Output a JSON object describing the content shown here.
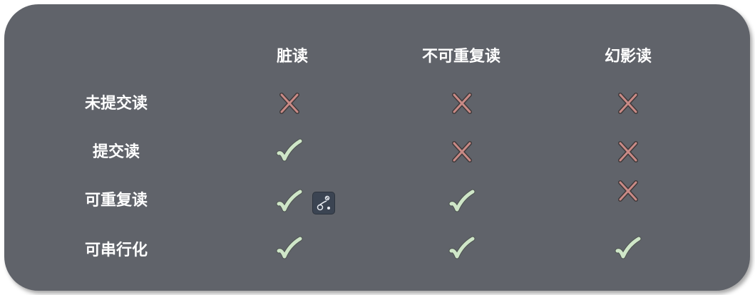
{
  "columns": [
    "脏读",
    "不可重复读",
    "幻影读"
  ],
  "rows": [
    {
      "label": "未提交读",
      "cells": [
        "cross",
        "cross",
        "cross"
      ]
    },
    {
      "label": "提交读",
      "cells": [
        "check",
        "cross",
        "cross"
      ]
    },
    {
      "label": "可重复读",
      "cells": [
        "check",
        "check",
        "cross"
      ]
    },
    {
      "label": "可串行化",
      "cells": [
        "check",
        "check",
        "check"
      ]
    }
  ],
  "icons": {
    "cross": "cross-icon",
    "check": "check-icon",
    "overlay": "translate-icon"
  },
  "colors": {
    "background": "#60636a",
    "text": "#ffffff",
    "cross": "#c98a86",
    "check": "#cfe6c8"
  }
}
